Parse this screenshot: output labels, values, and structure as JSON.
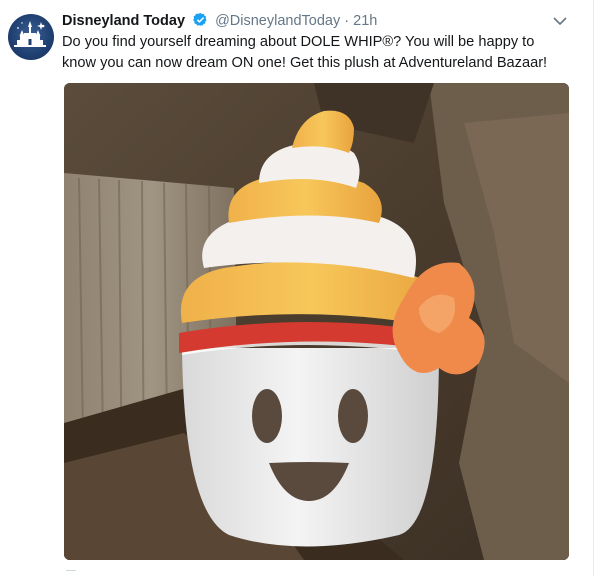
{
  "tweet": {
    "display_name": "Disneyland Today",
    "handle": "@DisneylandToday",
    "separator": "·",
    "time": "21h",
    "text": "Do you find yourself dreaming about DOLE WHIP®? You will be happy to know you can now dream ON one! Get this plush at Adventureland Bazaar!",
    "verified": true,
    "avatar_icon": "disney-castle-logo",
    "menu_icon": "chevron-down-icon",
    "media_description_icon": "photo",
    "colors": {
      "text": "#14171a",
      "muted": "#657786",
      "verified": "#1da1f2",
      "avatar_bg": "#1f3f70"
    }
  }
}
